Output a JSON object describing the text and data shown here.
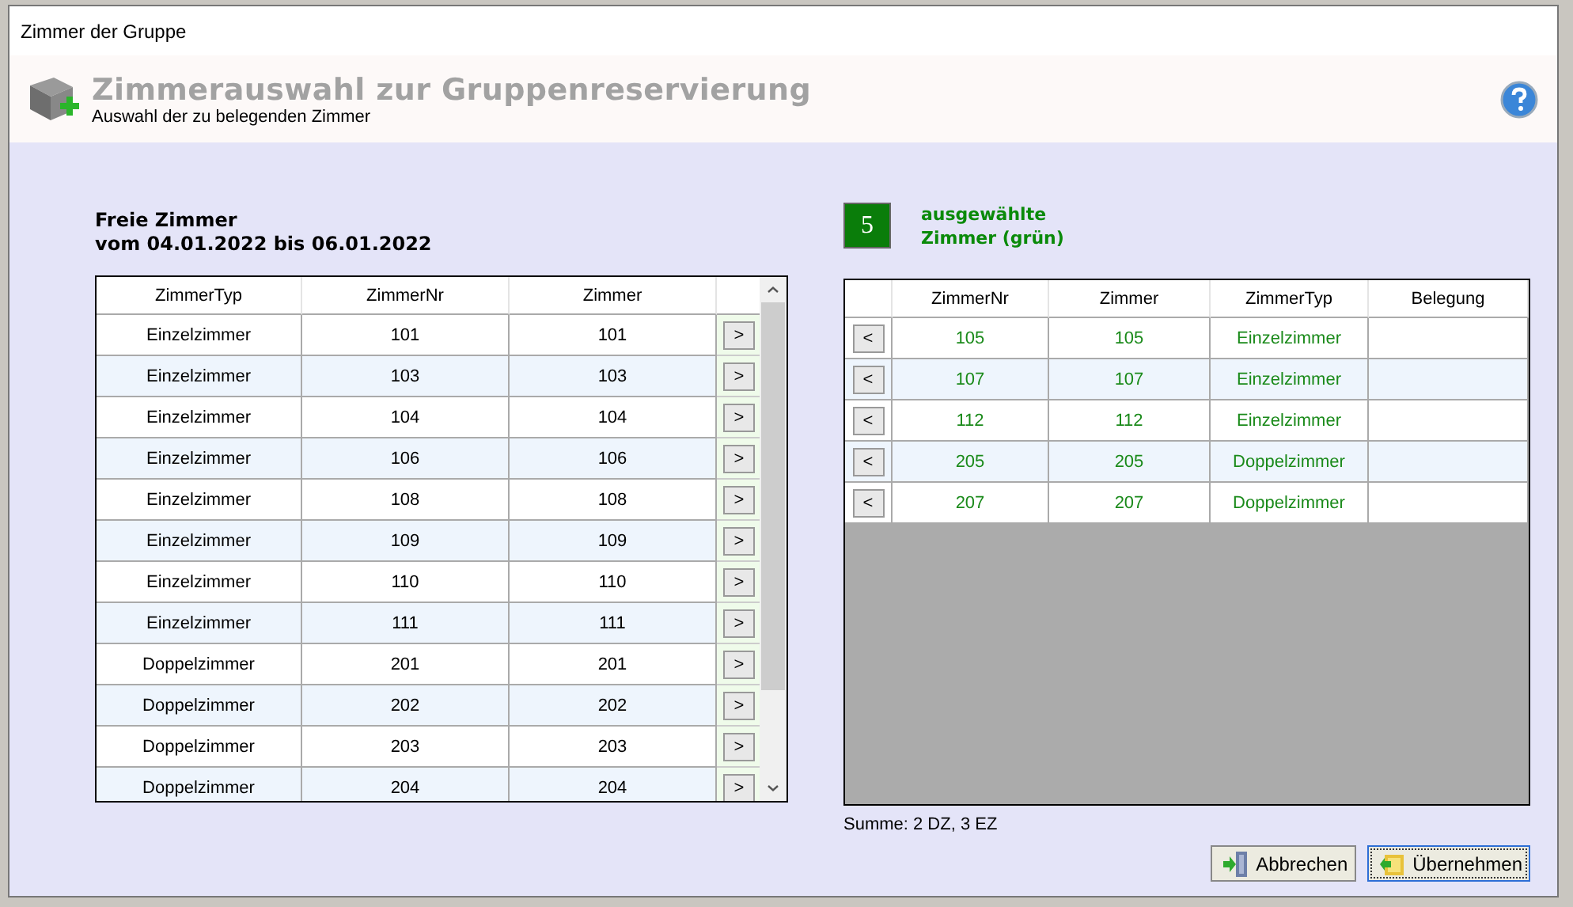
{
  "window": {
    "title": "Zimmer der Gruppe"
  },
  "header": {
    "title": "Zimmerauswahl zur Gruppenreservierung",
    "subtitle": "Auswahl der zu belegenden Zimmer"
  },
  "free_rooms": {
    "heading": [
      "Freie Zimmer",
      "vom 04.01.2022 bis 06.01.2022"
    ],
    "columns": [
      "ZimmerTyp",
      "ZimmerNr",
      "Zimmer"
    ],
    "rows": [
      {
        "type": "Einzelzimmer",
        "nr": "101",
        "room": "101",
        "action": ">"
      },
      {
        "type": "Einzelzimmer",
        "nr": "103",
        "room": "103",
        "action": ">"
      },
      {
        "type": "Einzelzimmer",
        "nr": "104",
        "room": "104",
        "action": ">"
      },
      {
        "type": "Einzelzimmer",
        "nr": "106",
        "room": "106",
        "action": ">"
      },
      {
        "type": "Einzelzimmer",
        "nr": "108",
        "room": "108",
        "action": ">"
      },
      {
        "type": "Einzelzimmer",
        "nr": "109",
        "room": "109",
        "action": ">"
      },
      {
        "type": "Einzelzimmer",
        "nr": "110",
        "room": "110",
        "action": ">"
      },
      {
        "type": "Einzelzimmer",
        "nr": "111",
        "room": "111",
        "action": ">"
      },
      {
        "type": "Doppelzimmer",
        "nr": "201",
        "room": "201",
        "action": ">"
      },
      {
        "type": "Doppelzimmer",
        "nr": "202",
        "room": "202",
        "action": ">"
      },
      {
        "type": "Doppelzimmer",
        "nr": "203",
        "room": "203",
        "action": ">"
      },
      {
        "type": "Doppelzimmer",
        "nr": "204",
        "room": "204",
        "action": ">"
      }
    ]
  },
  "selected_rooms": {
    "count": "5",
    "label": [
      "ausgewählte",
      "Zimmer (grün)"
    ],
    "columns": [
      "ZimmerNr",
      "Zimmer",
      "ZimmerTyp",
      "Belegung"
    ],
    "rows": [
      {
        "action": "<",
        "nr": "105",
        "room": "105",
        "type": "Einzelzimmer"
      },
      {
        "action": "<",
        "nr": "107",
        "room": "107",
        "type": "Einzelzimmer"
      },
      {
        "action": "<",
        "nr": "112",
        "room": "112",
        "type": "Einzelzimmer"
      },
      {
        "action": "<",
        "nr": "205",
        "room": "205",
        "type": "Doppelzimmer"
      },
      {
        "action": "<",
        "nr": "207",
        "room": "207",
        "type": "Doppelzimmer"
      }
    ]
  },
  "summary": "Summe: 2 DZ, 3 EZ",
  "buttons": [
    {
      "label": "Abbrechen",
      "kind": "cancel",
      "focused": false
    },
    {
      "label": "Übernehmen",
      "kind": "accept",
      "focused": true
    }
  ]
}
